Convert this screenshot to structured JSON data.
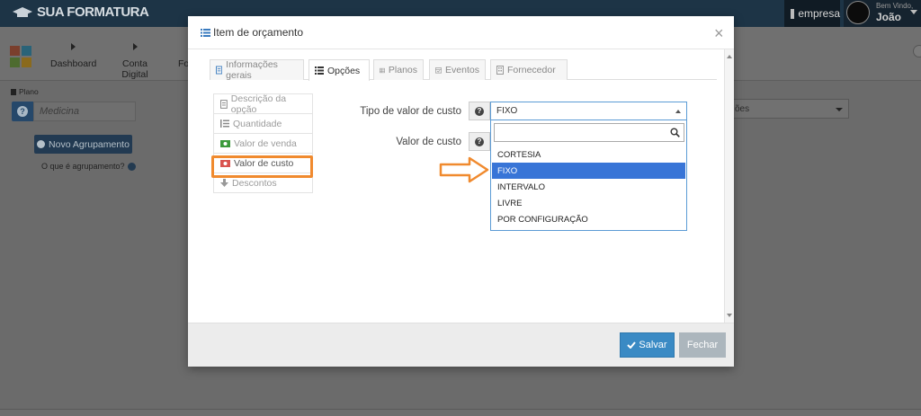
{
  "topbar": {
    "brand": "SUA FORMATURA",
    "empresa_label": "empresa",
    "welcome": "Bem Vindo,",
    "user_name": "João"
  },
  "nav": {
    "items": [
      {
        "label": "Dashboard",
        "icon": "triangle-right-icon"
      },
      {
        "label": "Conta Digital",
        "icon": "triangle-right-icon"
      },
      {
        "label": "Fo",
        "icon": ""
      }
    ]
  },
  "background": {
    "plano_label": "Plano",
    "plano_value": "Medicina",
    "novo_agrupamento": "Novo Agrupamento",
    "o_que_e": "O que é agrupamento?",
    "select_partial": "ões"
  },
  "modal": {
    "title": "Item de orçamento",
    "close": "×",
    "tabs": [
      {
        "label": "Informações gerais",
        "icon": "document-icon",
        "active": false
      },
      {
        "label": "Opções",
        "icon": "list-icon",
        "active": true
      },
      {
        "label": "Planos",
        "icon": "table-icon",
        "active": false
      },
      {
        "label": "Eventos",
        "icon": "calendar-icon",
        "active": false
      },
      {
        "label": "Fornecedor",
        "icon": "building-icon",
        "active": false
      }
    ],
    "options_list": [
      {
        "label": "Descrição da opção",
        "icon": "document-icon"
      },
      {
        "label": "Quantidade",
        "icon": "ordered-list-icon"
      },
      {
        "label": "Valor de venda",
        "icon": "money-green-icon"
      },
      {
        "label": "Valor de custo",
        "icon": "money-red-icon",
        "active": true
      },
      {
        "label": "Descontos",
        "icon": "arrow-down-icon"
      }
    ],
    "form": {
      "tipo_label": "Tipo de valor de custo",
      "valor_label": "Valor de custo",
      "selected": "FIXO",
      "search_value": "",
      "options": [
        "CORTESIA",
        "FIXO",
        "INTERVALO",
        "LIVRE",
        "POR CONFIGURAÇÃO"
      ]
    },
    "footer": {
      "save": "Salvar",
      "close": "Fechar"
    }
  },
  "colors": {
    "accent": "#3875d7",
    "annotation": "#f08a2e",
    "save_button": "#3a8ac4"
  }
}
